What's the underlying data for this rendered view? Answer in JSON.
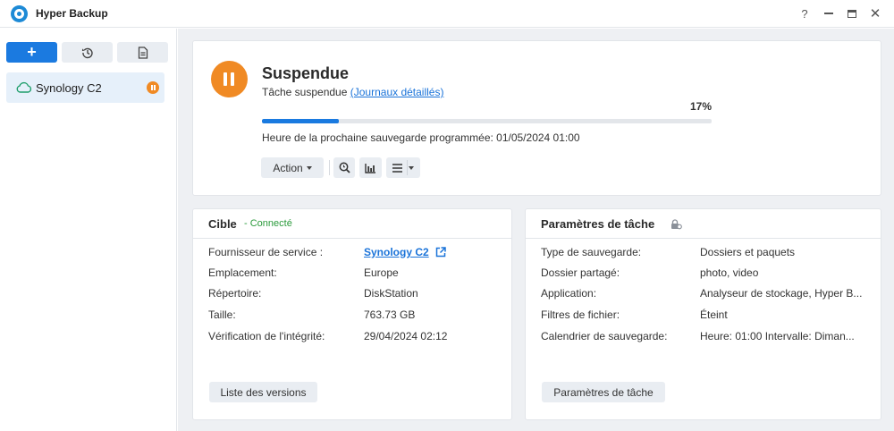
{
  "window": {
    "title": "Hyper Backup",
    "help_label": "?",
    "close_label": "✕"
  },
  "sidebar": {
    "add_label": "+",
    "tasks": [
      {
        "name": "Synology C2",
        "status": "paused"
      }
    ]
  },
  "status": {
    "title": "Suspendue",
    "subtitle": "Tâche suspendue",
    "detail_link": "(Journaux détaillés)",
    "progress_percent": 17,
    "progress_label": "17%",
    "next_backup": "Heure de la prochaine sauvegarde programmée: 01/05/2024 01:00",
    "action_label": "Action",
    "accent_color": "#f08a24",
    "progress_color": "#1a7ae0"
  },
  "target": {
    "title": "Cible",
    "connection": "- Connecté",
    "rows": [
      {
        "label": "Fournisseur de service :",
        "value": "Synology C2"
      },
      {
        "label": "Emplacement:",
        "value": "Europe"
      },
      {
        "label": "Répertoire:",
        "value": "DiskStation"
      },
      {
        "label": "Taille:",
        "value": "763.73 GB"
      },
      {
        "label": "Vérification de l'intégrité:",
        "value": "29/04/2024 02:12"
      }
    ],
    "button_label": "Liste des versions"
  },
  "params": {
    "title": "Paramètres de tâche",
    "rows": [
      {
        "label": "Type de sauvegarde:",
        "value": "Dossiers et paquets"
      },
      {
        "label": "Dossier partagé:",
        "value": "photo, video"
      },
      {
        "label": "Application:",
        "value": "Analyseur de stockage, Hyper B..."
      },
      {
        "label": "Filtres de fichier:",
        "value": "Éteint"
      },
      {
        "label": "Calendrier de sauvegarde:",
        "value": "Heure: 01:00 Intervalle: Diman..."
      }
    ],
    "button_label": "Paramètres de tâche"
  }
}
